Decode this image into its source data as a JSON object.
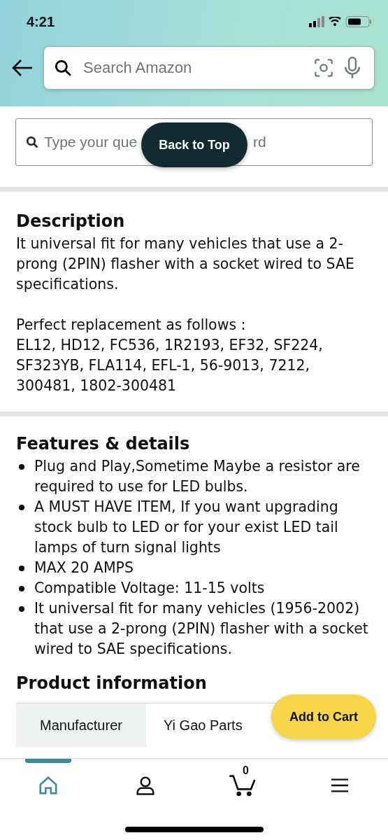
{
  "status_bar": {
    "time": "4:21"
  },
  "header": {
    "search": {
      "placeholder": "Search Amazon"
    }
  },
  "question_search": {
    "placeholder": "Type your que",
    "placeholder_tail": "rd"
  },
  "back_to_top": {
    "label": "Back to Top"
  },
  "description": {
    "title": "Description",
    "paragraphs": [
      "It universal fit for many vehicles that use a 2-prong (2PIN) flasher with a socket wired to SAE specifications.",
      "Perfect replacement as follows :\nEL12, HD12, FC536, 1R2193, EF32, SF224, SF323YB, FLA114, EFL-1, 56-9013, 7212, 300481, 1802-300481"
    ]
  },
  "features": {
    "title": "Features & details",
    "items": [
      "Plug and Play,Sometime Maybe a resistor are required to use for LED bulbs.",
      "A MUST HAVE ITEM, If you want upgrading stock bulb to LED or for your exist LED tail lamps of turn signal lights",
      "MAX 20 AMPS",
      "Compatible Voltage: 11-15 volts",
      "It universal fit for many vehicles (1956-2002) that use a 2-prong (2PIN) flasher with a socket wired to SAE specifications."
    ]
  },
  "product_information": {
    "title": "Product information",
    "rows": [
      {
        "label": "Manufacturer",
        "value": "Yi Gao Parts"
      }
    ]
  },
  "add_to_cart": {
    "label": "Add to Cart"
  },
  "bottom_nav": [
    {
      "kind": "home",
      "selected": true
    },
    {
      "kind": "account",
      "selected": false
    },
    {
      "kind": "cart",
      "selected": false,
      "count": "0"
    },
    {
      "kind": "menu",
      "selected": false
    }
  ]
}
